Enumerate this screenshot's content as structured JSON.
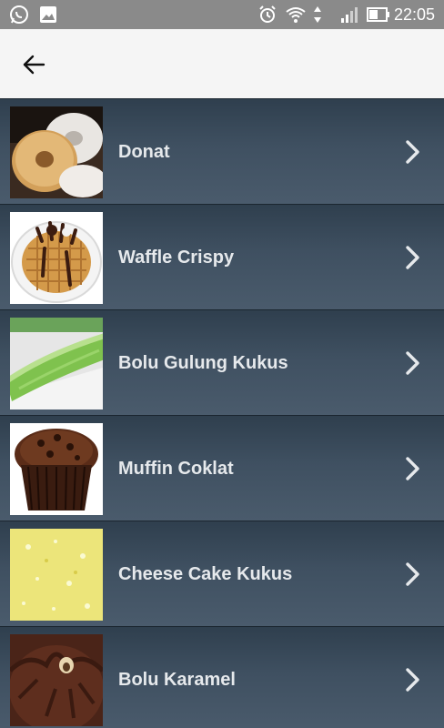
{
  "status_bar": {
    "time": "22:05",
    "left_icons": [
      "whatsapp-icon",
      "gallery-icon"
    ],
    "right_icons": [
      "alarm-icon",
      "wifi-icon",
      "signal-icon",
      "battery-icon"
    ]
  },
  "app_bar": {
    "back_icon": "arrow-left-icon"
  },
  "recipes": [
    {
      "label": "Donat",
      "thumb": "donut"
    },
    {
      "label": "Waffle Crispy",
      "thumb": "waffle"
    },
    {
      "label": "Bolu Gulung Kukus",
      "thumb": "roll"
    },
    {
      "label": "Muffin Coklat",
      "thumb": "muffin"
    },
    {
      "label": "Cheese Cake Kukus",
      "thumb": "cheese"
    },
    {
      "label": "Bolu Karamel",
      "thumb": "caramel"
    }
  ],
  "colors": {
    "status_bar": "#8a8a8a",
    "app_bar": "#f5f5f5",
    "list_item": "#3f5061",
    "label_text": "#e6e9ec"
  }
}
